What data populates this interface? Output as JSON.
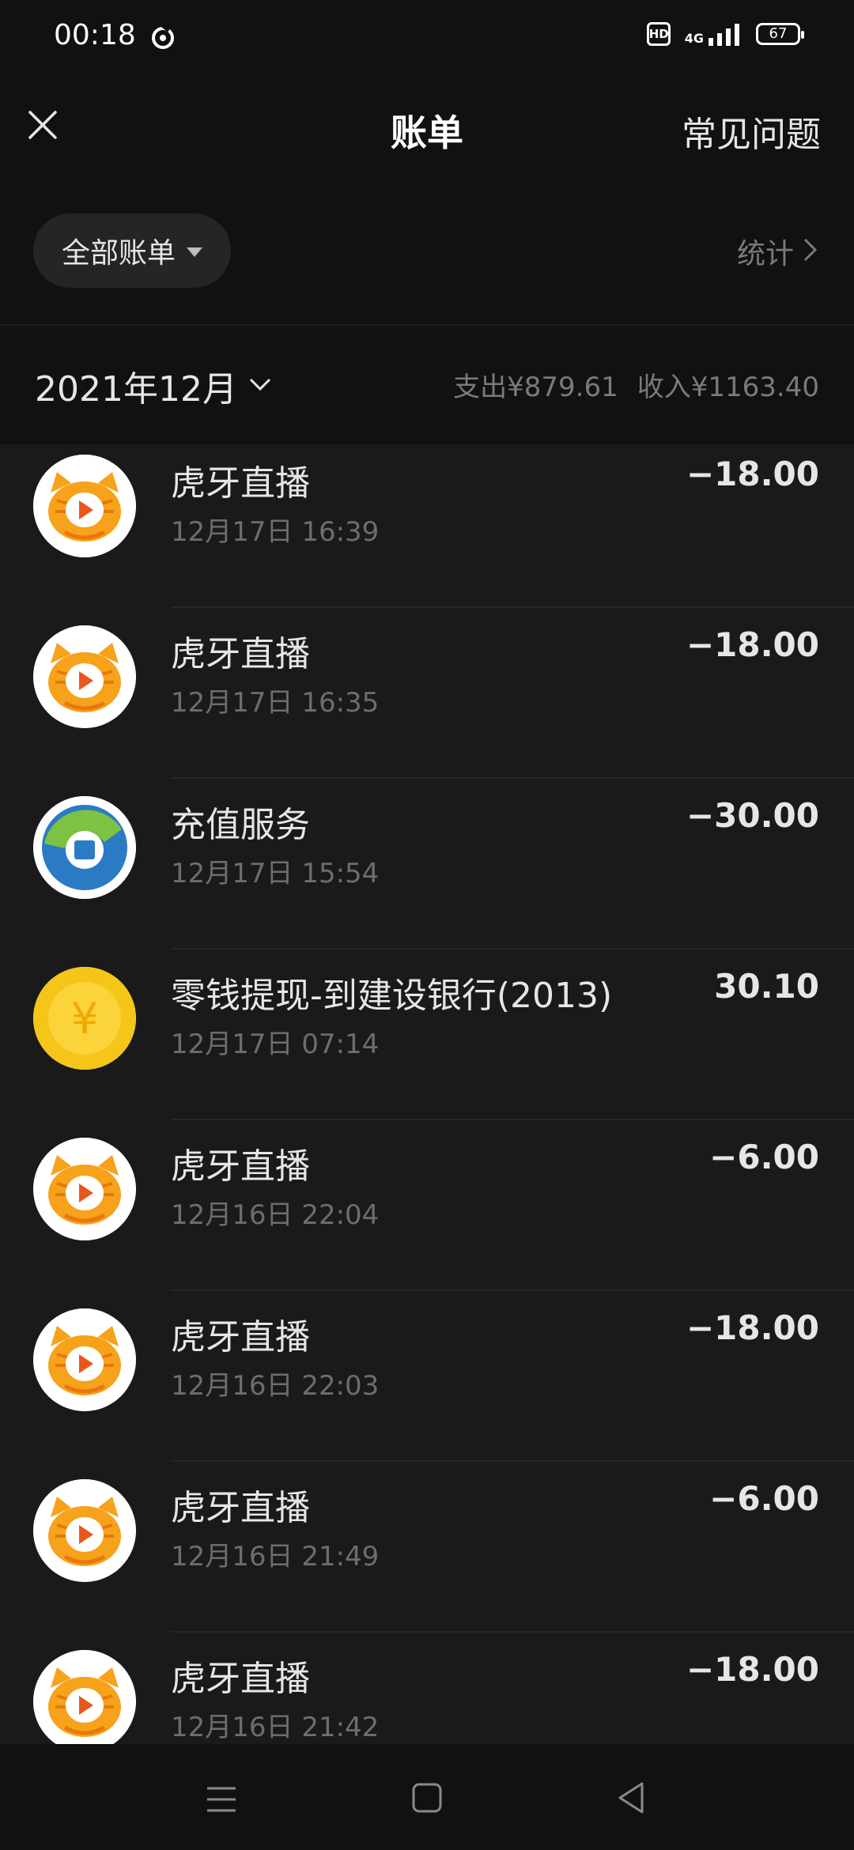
{
  "status_bar": {
    "time": "00:18",
    "network_label": "4G",
    "battery": "67",
    "hd_label": "HD"
  },
  "header": {
    "title": "账单",
    "faq_label": "常见问题"
  },
  "filter": {
    "label": "全部账单",
    "stats_label": "统计"
  },
  "month": {
    "label": "2021年12月",
    "expense": "支出¥879.61",
    "income": "收入¥1163.40"
  },
  "colors": {
    "background": "#111111",
    "list_background": "#1a1a1a",
    "huya_orange": "#f7a21b",
    "coin_yellow": "#f5c518"
  },
  "bills": [
    {
      "merchant": "虎牙直播",
      "time": "12月17日 16:39",
      "amount": "−18.00",
      "icon": "huya-tiger-icon"
    },
    {
      "merchant": "虎牙直播",
      "time": "12月17日 16:35",
      "amount": "−18.00",
      "icon": "huya-tiger-icon"
    },
    {
      "merchant": "充值服务",
      "time": "12月17日 15:54",
      "amount": "−30.00",
      "icon": "recharge-service-icon"
    },
    {
      "merchant": "零钱提现-到建设银行(2013)",
      "time": "12月17日 07:14",
      "amount": "30.10",
      "icon": "yuan-coin-icon"
    },
    {
      "merchant": "虎牙直播",
      "time": "12月16日 22:04",
      "amount": "−6.00",
      "icon": "huya-tiger-icon"
    },
    {
      "merchant": "虎牙直播",
      "time": "12月16日 22:03",
      "amount": "−18.00",
      "icon": "huya-tiger-icon"
    },
    {
      "merchant": "虎牙直播",
      "time": "12月16日 21:49",
      "amount": "−6.00",
      "icon": "huya-tiger-icon"
    },
    {
      "merchant": "虎牙直播",
      "time": "12月16日 21:42",
      "amount": "−18.00",
      "icon": "huya-tiger-icon"
    }
  ],
  "icons": {
    "close": "close-icon",
    "menu": "menu-icon",
    "home": "home-icon",
    "back": "back-icon"
  }
}
